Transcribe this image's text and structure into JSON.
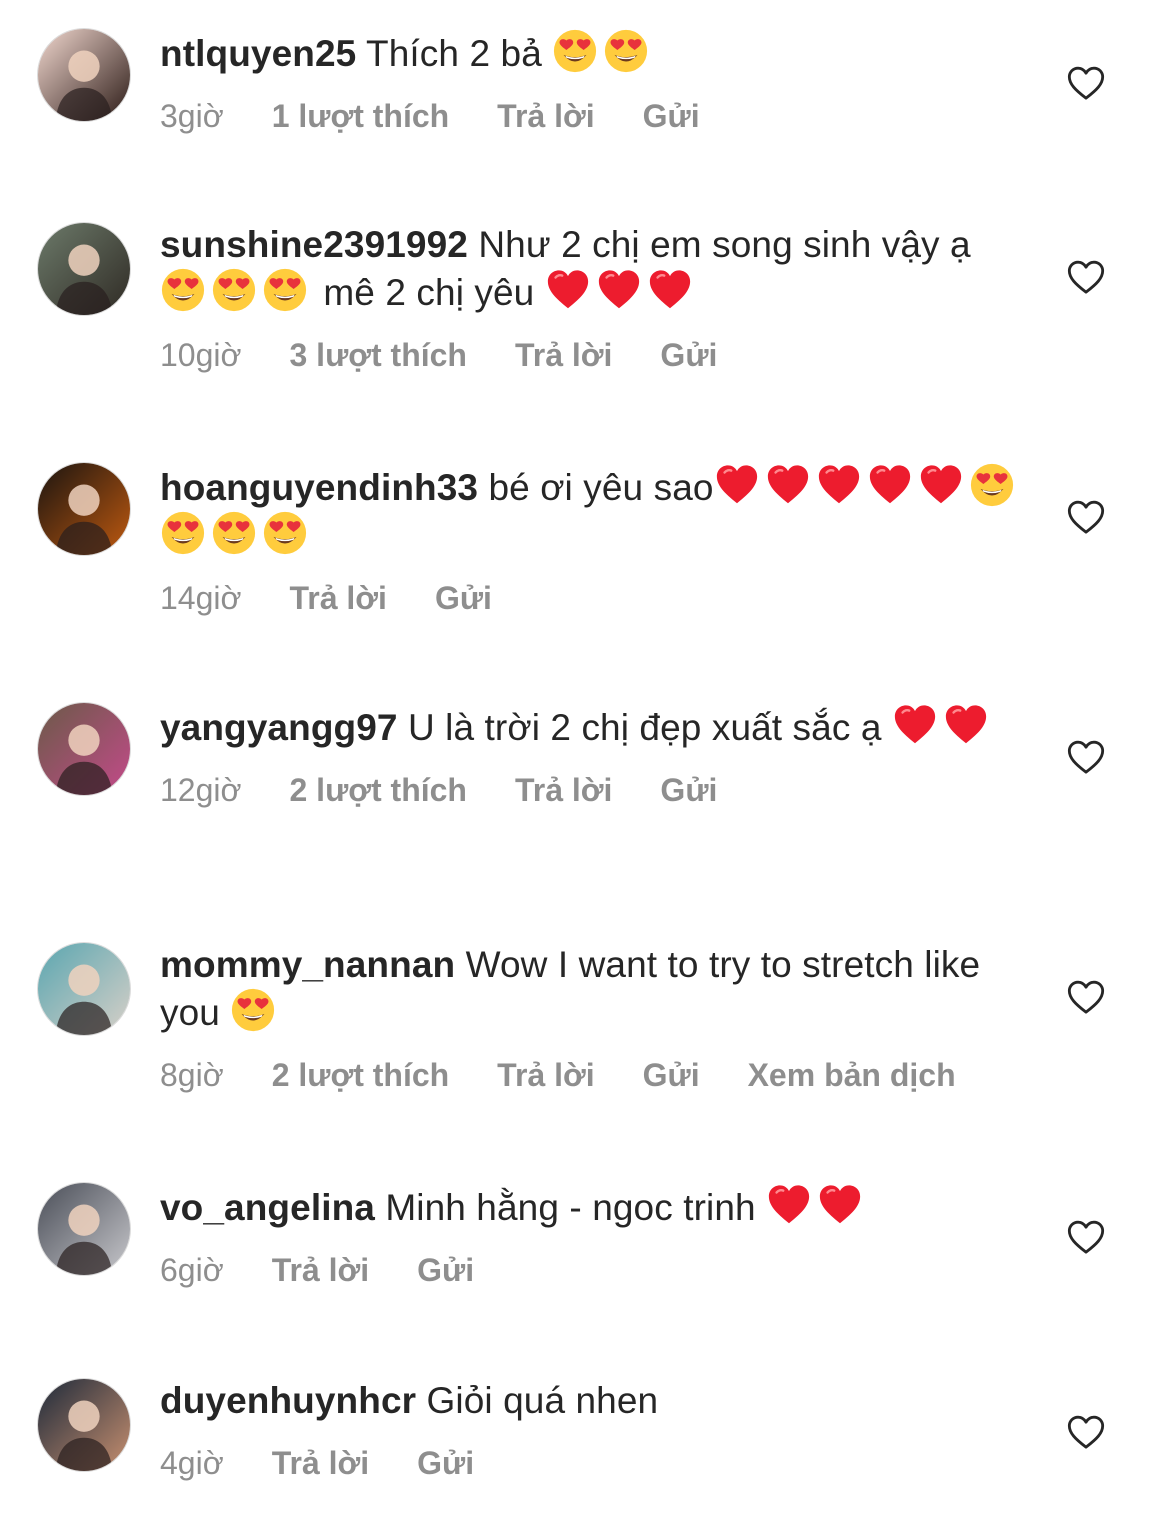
{
  "comments": [
    {
      "username": "ntlquyen25",
      "text_parts": [
        " Thích 2 bả "
      ],
      "emojis_after": [
        "heart-eyes",
        "heart-eyes"
      ],
      "time": "3giờ",
      "likes": "1 lượt thích",
      "reply": "Trả lời",
      "send": "Gửi",
      "translate": ""
    },
    {
      "username": "sunshine2391992",
      "text_parts": [
        " Như 2 chị em song sinh vậy ạ "
      ],
      "emojis_mid": [
        "heart-eyes",
        "heart-eyes",
        "heart-eyes"
      ],
      "text_after": " mê 2 chị yêu ",
      "emojis_after": [
        "red-heart",
        "red-heart",
        "red-heart"
      ],
      "time": "10giờ",
      "likes": "3 lượt thích",
      "reply": "Trả lời",
      "send": "Gửi",
      "translate": ""
    },
    {
      "username": "hoanguyendinh33",
      "text_parts": [
        " bé ơi yêu sao"
      ],
      "emojis_after": [
        "red-heart",
        "red-heart",
        "red-heart",
        "red-heart",
        "red-heart",
        "heart-eyes",
        "heart-eyes",
        "heart-eyes",
        "heart-eyes"
      ],
      "time": "14giờ",
      "likes": "",
      "reply": "Trả lời",
      "send": "Gửi",
      "translate": ""
    },
    {
      "username": "yangyangg97",
      "text_parts": [
        " U là trời 2 chị đẹp xuất sắc ạ "
      ],
      "emojis_after": [
        "red-heart",
        "red-heart"
      ],
      "time": "12giờ",
      "likes": "2 lượt thích",
      "reply": "Trả lời",
      "send": "Gửi",
      "translate": ""
    },
    {
      "username": "mommy_nannan",
      "text_parts": [
        " Wow I want to try to stretch like you "
      ],
      "emojis_after": [
        "heart-eyes"
      ],
      "time": "8giờ",
      "likes": "2 lượt thích",
      "reply": "Trả lời",
      "send": "Gửi",
      "translate": "Xem bản dịch"
    },
    {
      "username": "vo_angelina",
      "text_parts": [
        " Minh hằng - ngoc trinh "
      ],
      "emojis_after": [
        "red-heart",
        "red-heart"
      ],
      "time": "6giờ",
      "likes": "",
      "reply": "Trả lời",
      "send": "Gửi",
      "translate": ""
    },
    {
      "username": "duyenhuynhcr",
      "text_parts": [
        " Giỏi quá nhen"
      ],
      "emojis_after": [],
      "time": "4giờ",
      "likes": "",
      "reply": "Trả lời",
      "send": "Gửi",
      "translate": ""
    }
  ],
  "colors": {
    "text": "#262626",
    "meta": "#8e8e8e",
    "heart_red": "#ed1c2e",
    "emoji_yellow": "#ffcc3d"
  }
}
